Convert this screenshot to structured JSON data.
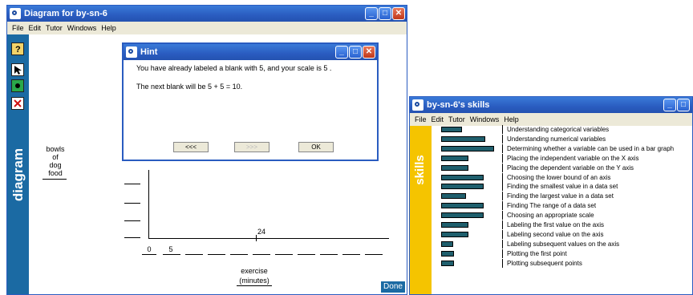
{
  "diagram_window": {
    "title": "Diagram for by-sn-6",
    "menu": [
      "File",
      "Edit",
      "Tutor",
      "Windows",
      "Help"
    ],
    "side_label": "diagram",
    "tools": [
      "help-icon",
      "pointer-icon",
      "point-tool-icon",
      "delete-icon"
    ],
    "y_label": [
      "bowls",
      "of",
      "dog",
      "food"
    ],
    "point_value": "24",
    "x_ticks": [
      "0",
      "5"
    ],
    "x_label": [
      "exercise",
      "(minutes)"
    ],
    "done_label": "Done"
  },
  "hint_dialog": {
    "title": "Hint",
    "line1": "You have already labeled a blank with 5, and your scale is 5 .",
    "line2": "The next blank will be 5 + 5 = 10.",
    "prev_label": "<<<",
    "next_label": ">>>",
    "ok_label": "OK"
  },
  "skills_window": {
    "title": "by-sn-6's skills",
    "menu": [
      "File",
      "Edit",
      "Tutor",
      "Windows",
      "Help"
    ],
    "side_label": "skills",
    "skills": [
      {
        "label": "Understanding categorical variables",
        "level": 0.3
      },
      {
        "label": "Understanding numerical variables",
        "level": 0.66
      },
      {
        "label": "Determining whether a variable can be used in a bar graph",
        "level": 0.8
      },
      {
        "label": "Placing the independent variable on the X axis",
        "level": 0.4
      },
      {
        "label": "Placing the dependent variable on the Y axis",
        "level": 0.4
      },
      {
        "label": "Choosing the lower bound of an axis",
        "level": 0.64
      },
      {
        "label": "Finding the smallest value in a data set",
        "level": 0.64
      },
      {
        "label": "Finding the largest value in a data set",
        "level": 0.36
      },
      {
        "label": "Finding The range of a data set",
        "level": 0.64
      },
      {
        "label": "Choosing an appropriate scale",
        "level": 0.64
      },
      {
        "label": "Labeling the first value on the axis",
        "level": 0.4
      },
      {
        "label": "Labeling second value on the axis",
        "level": 0.4
      },
      {
        "label": "Labeling subsequent values on the axis",
        "level": 0.16
      },
      {
        "label": "Plotting the first point",
        "level": 0.18
      },
      {
        "label": "Plotting subsequent points",
        "level": 0.18
      }
    ]
  },
  "colors": {
    "titlebar": "#2a5cc0",
    "diagram_sidebar": "#1b6aa3",
    "skills_sidebar": "#f5c400",
    "skill_bar": "#1f5f6d"
  }
}
